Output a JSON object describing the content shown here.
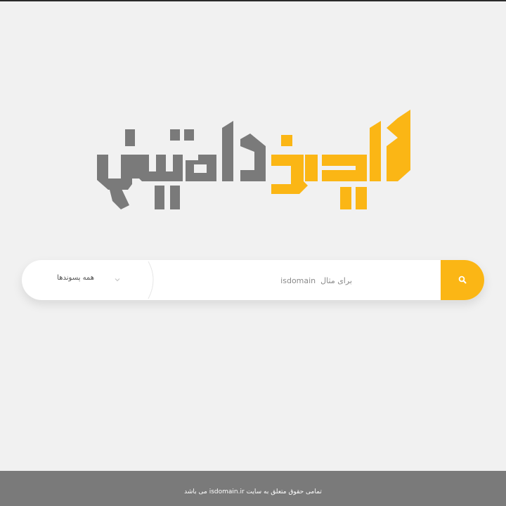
{
  "logo": {
    "text": "ایزدامین",
    "colors": {
      "accent": "#fbb615",
      "primary": "#7a7a7a"
    }
  },
  "search": {
    "placeholder": "برای مثال  isdomain",
    "button_icon": "search-icon",
    "extension_select": {
      "selected": "همه پسوندها",
      "icon": "chevron-down-icon"
    }
  },
  "footer": {
    "text": "تمامی حقوق متعلق به سایت isdomain.ir می باشد"
  },
  "colors": {
    "background": "#f1f1f1",
    "search_button": "#fbb615",
    "footer_background": "#7a7a7a"
  }
}
